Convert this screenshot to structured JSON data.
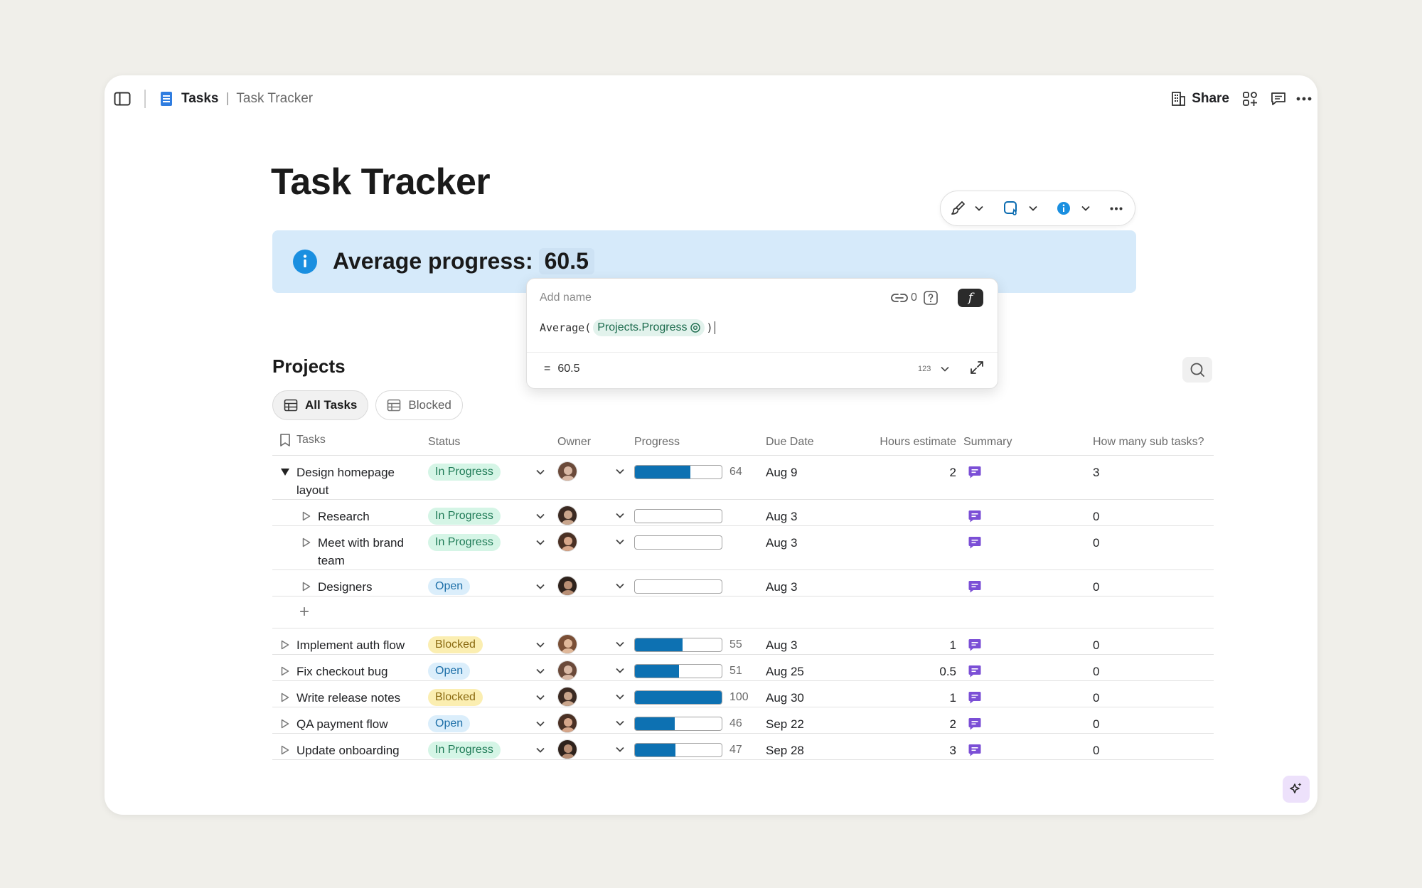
{
  "breadcrumb": {
    "doc": "Tasks",
    "separator": "|",
    "page": "Task Tracker"
  },
  "header": {
    "share_label": "Share"
  },
  "page": {
    "title": "Task Tracker"
  },
  "callout": {
    "label": "Average progress:",
    "value": "60.5",
    "bg_color": "#d6eafa",
    "icon": "info-icon"
  },
  "formula": {
    "name_placeholder": "Add name",
    "link_count": "0",
    "fx_label": "f",
    "function": "Average(",
    "reference": "Projects.Progress",
    "closing": ")",
    "result_prefix": "=",
    "result": "60.5",
    "format_label": "123"
  },
  "projects": {
    "title": "Projects",
    "tabs": [
      {
        "label": "All Tasks",
        "active": true
      },
      {
        "label": "Blocked",
        "active": false
      }
    ],
    "columns": [
      "Tasks",
      "Status",
      "Owner",
      "Progress",
      "Due Date",
      "Hours estimate",
      "Summary",
      "How many sub tasks?"
    ],
    "add_row_label": "+",
    "rows": [
      {
        "task": "Design homepage layout",
        "level": 0,
        "expanded": true,
        "status": "In Progress",
        "progress": 64,
        "progress_label": "64",
        "due": "Aug 9",
        "hours": "2",
        "subtasks": "3"
      },
      {
        "task": "Research",
        "level": 1,
        "status": "In Progress",
        "progress": 0,
        "progress_label": "",
        "due": "Aug 3",
        "hours": "",
        "subtasks": "0"
      },
      {
        "task": "Meet with brand team",
        "level": 1,
        "status": "In Progress",
        "progress": 0,
        "progress_label": "",
        "due": "Aug 3",
        "hours": "",
        "subtasks": "0"
      },
      {
        "task": "Designers",
        "level": 1,
        "status": "Open",
        "progress": 0,
        "progress_label": "",
        "due": "Aug 3",
        "hours": "",
        "subtasks": "0"
      },
      {
        "task": "Implement auth flow",
        "level": 0,
        "status": "Blocked",
        "progress": 55,
        "progress_label": "55",
        "due": "Aug 3",
        "hours": "1",
        "subtasks": "0"
      },
      {
        "task": "Fix checkout bug",
        "level": 0,
        "status": "Open",
        "progress": 51,
        "progress_label": "51",
        "due": "Aug 25",
        "hours": "0.5",
        "subtasks": "0"
      },
      {
        "task": "Write release notes",
        "level": 0,
        "status": "Blocked",
        "progress": 100,
        "progress_label": "100",
        "due": "Aug 30",
        "hours": "1",
        "subtasks": "0"
      },
      {
        "task": "QA payment flow",
        "level": 0,
        "status": "Open",
        "progress": 46,
        "progress_label": "46",
        "due": "Sep 22",
        "hours": "2",
        "subtasks": "0"
      },
      {
        "task": "Update onboarding",
        "level": 0,
        "status": "In Progress",
        "progress": 47,
        "progress_label": "47",
        "due": "Sep 28",
        "hours": "3",
        "subtasks": "0"
      }
    ]
  },
  "status_colors": {
    "In Progress": {
      "bg": "#d5f5e6",
      "fg": "#1d7a55"
    },
    "Open": {
      "bg": "#dbeefb",
      "fg": "#1d6fa8"
    },
    "Blocked": {
      "bg": "#fbeeb1",
      "fg": "#8a6a10"
    }
  },
  "colors": {
    "progress_fill": "#0d71b2",
    "summary_icon": "#7b4fd6",
    "ai_button_bg": "#ede1fb"
  }
}
